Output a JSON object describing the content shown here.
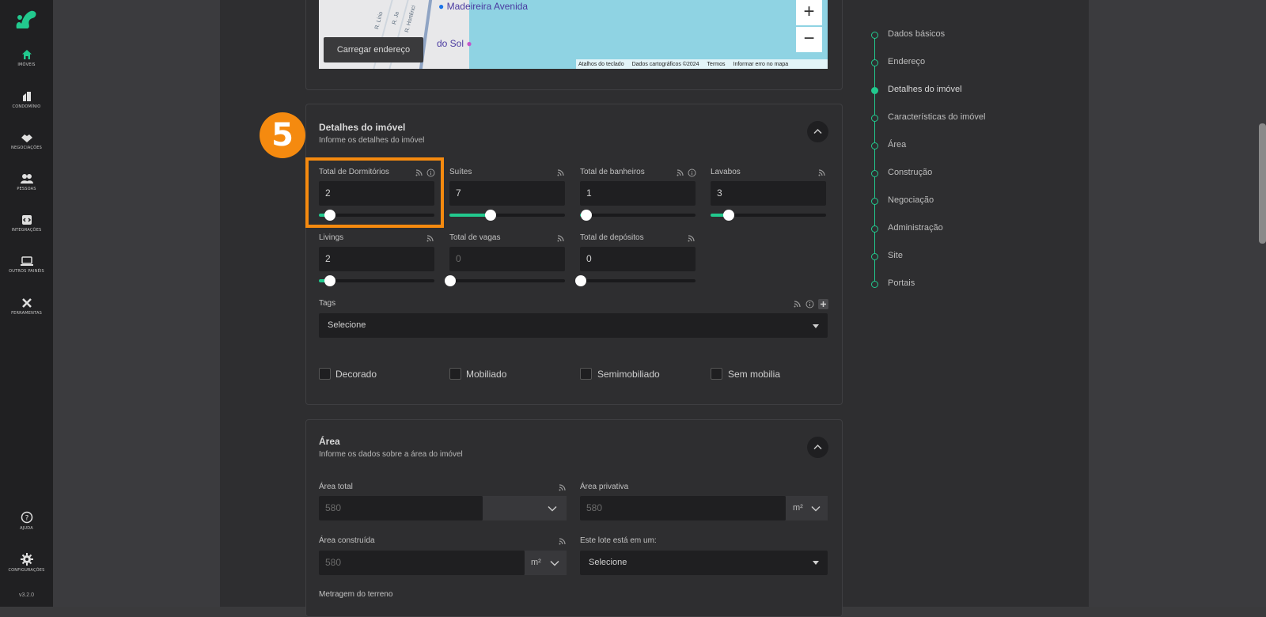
{
  "app": {
    "version": "v3.2.0",
    "accent": "#22c98e",
    "highlight_color": "#f58a0f"
  },
  "nav": [
    {
      "label": "IMÓVEIS",
      "icon": "home-icon"
    },
    {
      "label": "CONDOMÍNIO",
      "icon": "building-icon"
    },
    {
      "label": "NEGOCIAÇÕES",
      "icon": "handshake-icon"
    },
    {
      "label": "PESSOAS",
      "icon": "people-icon"
    },
    {
      "label": "INTEGRAÇÕES",
      "icon": "integration-icon"
    },
    {
      "label": "OUTROS PAINÉIS",
      "icon": "laptop-icon"
    },
    {
      "label": "FERRAMENTAS",
      "icon": "tools-icon"
    }
  ],
  "nav_bottom": [
    {
      "label": "AJUDA",
      "icon": "help-icon"
    },
    {
      "label": "CONFIGURAÇÕES",
      "icon": "settings-icon"
    }
  ],
  "map": {
    "load_button": "Carregar endereço",
    "poi_1": "Madeireira Avenida",
    "poi_2": "do Sol",
    "streets": [
      "R. Lírio",
      "R. Ja",
      "R. Hortênci"
    ],
    "footer": [
      "Atalhos do teclado",
      "Dados cartográficos ©2024",
      "Termos",
      "Informar erro no mapa"
    ],
    "zoom_in": "+",
    "zoom_out": "−"
  },
  "step_badge": "5",
  "details": {
    "title": "Detalhes do imóvel",
    "subtitle": "Informe os detalhes do imóvel",
    "fields": [
      {
        "label": "Total de Dormitórios",
        "value": "2",
        "level": 0.09,
        "has_info": true
      },
      {
        "label": "Suítes",
        "value": "7",
        "level": 0.35,
        "has_info": false
      },
      {
        "label": "Total de banheiros",
        "value": "1",
        "level": 0.05,
        "has_info": true
      },
      {
        "label": "Lavabos",
        "value": "3",
        "level": 0.15,
        "has_info": false
      },
      {
        "label": "Livings",
        "value": "2",
        "level": 0.09,
        "has_info": false
      },
      {
        "label": "Total de vagas",
        "value": "0",
        "level": 0.0,
        "has_info": false
      },
      {
        "label": "Total de depósitos",
        "value": "0",
        "level": 0.0,
        "has_info": false
      }
    ],
    "tags_label": "Tags",
    "tags_value": "Selecione",
    "furnish": [
      "Decorado",
      "Mobiliado",
      "Semimobiliado",
      "Sem mobilia"
    ]
  },
  "area": {
    "title": "Área",
    "subtitle": "Informe os dados sobre a área do imóvel",
    "total_label": "Área total",
    "total_value": "580",
    "total_unit": "",
    "private_label": "Área privativa",
    "private_value": "580",
    "private_unit": "m²",
    "built_label": "Área construída",
    "built_value": "580",
    "built_unit": "m²",
    "lot_label": "Este lote está em um:",
    "lot_value": "Selecione",
    "terrain_label": "Metragem do terreno"
  },
  "timeline": [
    {
      "label": "Dados básicos",
      "active": false
    },
    {
      "label": "Endereço",
      "active": false
    },
    {
      "label": "Detalhes do imóvel",
      "active": true
    },
    {
      "label": "Características do imóvel",
      "active": false
    },
    {
      "label": "Área",
      "active": false
    },
    {
      "label": "Construção",
      "active": false
    },
    {
      "label": "Negociação",
      "active": false
    },
    {
      "label": "Administração",
      "active": false
    },
    {
      "label": "Site",
      "active": false
    },
    {
      "label": "Portais",
      "active": false
    }
  ]
}
